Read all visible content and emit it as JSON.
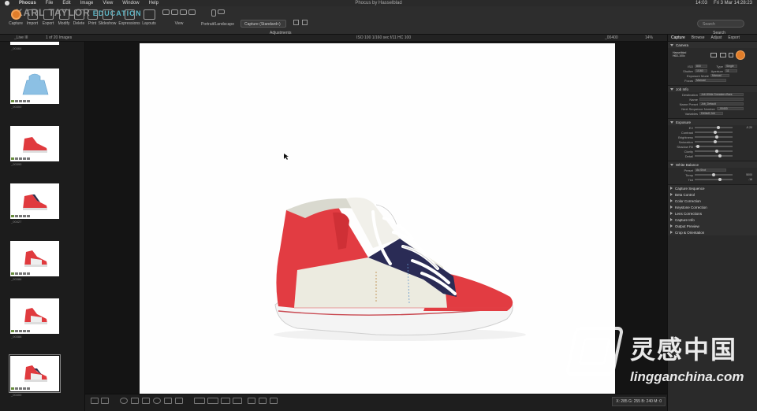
{
  "menubar": {
    "app": "Phocus",
    "items": [
      "File",
      "Edit",
      "Image",
      "View",
      "Window",
      "Help"
    ],
    "title": "Phocus by Hasselblad",
    "time": "14:03",
    "date": "Fri 3 Mar 14:28:23"
  },
  "brand": {
    "name": "KARL TAYLOR",
    "sub": "EDUCATION"
  },
  "toolbar": {
    "buttons": [
      "Capture",
      "Import",
      "Export",
      "Modify",
      "Delete",
      "Print",
      "Slideshow",
      "Expressions",
      "Layouts"
    ],
    "view_label": "View",
    "portrait_label": "Portrait/Landscape",
    "capture_select": "Capture (Standard+)",
    "adjustments_label": "Adjustments",
    "search_placeholder": "Search",
    "search_label": "Search"
  },
  "subbar": {
    "folder": "_Live III",
    "count": "1 of 20 Images",
    "info": "ISO 100  1/160 sec  f/11  HC 100",
    "zoom": "Fit",
    "file": "_00400",
    "scale": "14%"
  },
  "thumbnails": [
    "_00464",
    "_00300",
    "_00390",
    "_00427",
    "_00386",
    "_00388",
    "_00400"
  ],
  "tool_tabs": [
    "Capture",
    "Browse",
    "Adjust",
    "Export"
  ],
  "camera": {
    "title": "Camera",
    "model": "Hasselblad H6D-100c",
    "iso": "800",
    "mode": "Manual",
    "shutter": "1/160",
    "aperture": "11",
    "exposure_mode": "Manual",
    "program": "Single"
  },
  "job": {
    "title": "Job Info",
    "destination": "Job White Sneakers Bars",
    "name": "",
    "preset": "Job_Default",
    "next": "_00400",
    "variables": "Default Job"
  },
  "exposure": {
    "title": "Exposure",
    "rows": [
      [
        "EV",
        "-0.20"
      ],
      [
        "Contrast",
        ""
      ],
      [
        "Brightness",
        ""
      ],
      [
        "Saturation",
        ""
      ],
      [
        "Shadow Fill",
        ""
      ],
      [
        "Clarity",
        ""
      ],
      [
        "Detail",
        ""
      ]
    ]
  },
  "wb": {
    "title": "White Balance",
    "preset": "As Shot",
    "temp": "5000",
    "tint": "-16"
  },
  "collapsed": [
    "Capture Sequence",
    "Beta Control",
    "Color Correction",
    "Keystone Correction",
    "Lens Corrections",
    "Capture Info",
    "Output Preview",
    "Crop & Orientation"
  ],
  "coords": "X: 285  G: 255  B: 240  M: 0",
  "watermark": {
    "cn": "灵感中国",
    "url": "lingganchina.com"
  }
}
